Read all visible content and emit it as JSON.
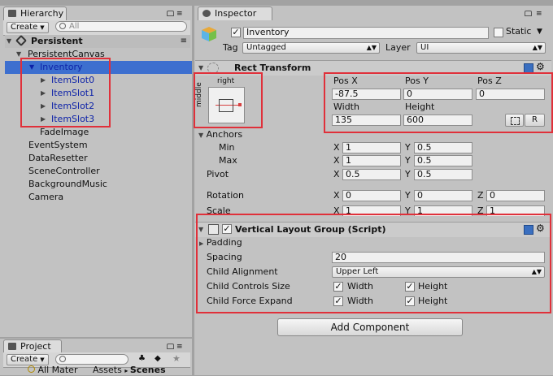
{
  "hierarchy": {
    "tab": "Hierarchy",
    "create": "Create",
    "search_placeholder": "All",
    "scene": "Persistent",
    "items": [
      {
        "label": "PersistentCanvas"
      },
      {
        "label": "Inventory"
      },
      {
        "label": "ItemSlot0"
      },
      {
        "label": "ItemSlot1"
      },
      {
        "label": "ItemSlot2"
      },
      {
        "label": "ItemSlot3"
      },
      {
        "label": "FadeImage"
      },
      {
        "label": "EventSystem"
      },
      {
        "label": "DataResetter"
      },
      {
        "label": "SceneController"
      },
      {
        "label": "BackgroundMusic"
      },
      {
        "label": "Camera"
      }
    ]
  },
  "project": {
    "tab": "Project",
    "create": "Create",
    "bottom_item": "All Mater",
    "breadcrumb_1": "Assets",
    "breadcrumb_2": "Scenes"
  },
  "inspector": {
    "tab": "Inspector",
    "object_name": "Inventory",
    "static_label": "Static",
    "tag_label": "Tag",
    "tag_value": "Untagged",
    "layer_label": "Layer",
    "layer_value": "UI",
    "rect": {
      "title": "Rect Transform",
      "anchor_h": "right",
      "anchor_v": "middle",
      "posx_label": "Pos X",
      "posx": "-87.5",
      "posy_label": "Pos Y",
      "posy": "0",
      "posz_label": "Pos Z",
      "posz": "0",
      "width_label": "Width",
      "width": "135",
      "height_label": "Height",
      "height": "600",
      "r_button": "R",
      "anchors_label": "Anchors",
      "min_label": "Min",
      "min_x": "1",
      "min_y": "0.5",
      "max_label": "Max",
      "max_x": "1",
      "max_y": "0.5",
      "pivot_label": "Pivot",
      "pivot_x": "0.5",
      "pivot_y": "0.5",
      "rotation_label": "Rotation",
      "rot_x": "0",
      "rot_y": "0",
      "rot_z": "0",
      "scale_label": "Scale",
      "scale_x": "1",
      "scale_y": "1",
      "scale_z": "1",
      "x": "X",
      "y": "Y",
      "z": "Z"
    },
    "vlg": {
      "title": "Vertical Layout Group (Script)",
      "padding_label": "Padding",
      "spacing_label": "Spacing",
      "spacing": "20",
      "alignment_label": "Child Alignment",
      "alignment": "Upper Left",
      "controls_label": "Child Controls Size",
      "expand_label": "Child Force Expand",
      "width": "Width",
      "height": "Height"
    },
    "add_component": "Add Component"
  }
}
